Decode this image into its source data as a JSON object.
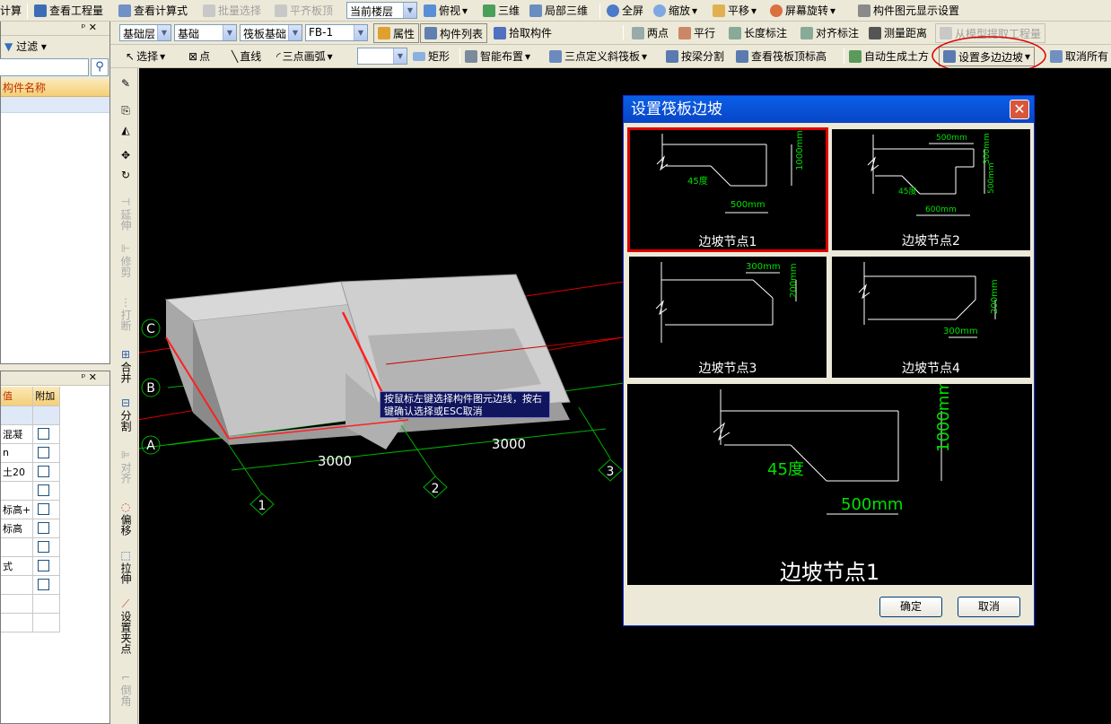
{
  "toolbar1": {
    "calc": "计算",
    "view_qty": "查看工程量",
    "view_formula": "查看计算式",
    "batch_select": "批量选择",
    "flush_top": "平齐板顶",
    "floor_select": "当前楼层",
    "top_view": "俯视",
    "three_d": "三维",
    "partial_3d": "局部三维",
    "fullscreen": "全屏",
    "zoom": "缩放",
    "pan": "平移",
    "rotate": "屏幕旋转",
    "display_settings": "构件图元显示设置"
  },
  "toolbar2": {
    "layer": "基础层",
    "category": "基础",
    "type": "筏板基础",
    "element": "FB-1",
    "properties": "属性",
    "element_list": "构件列表",
    "pick_element": "拾取构件",
    "two_points": "两点",
    "parallel": "平行",
    "length_dim": "长度标注",
    "align_dim": "对齐标注",
    "measure": "测量距离",
    "extract_model": "从模型提取工程量"
  },
  "toolbar3": {
    "select": "选择",
    "point": "点",
    "line": "直线",
    "arc3": "三点画弧",
    "rect": "矩形",
    "smart_layout": "智能布置",
    "define_slope": "三点定义斜筏板",
    "split_beam": "按梁分割",
    "view_top_elev": "查看筏板顶标高",
    "auto_earthwork": "自动生成土方",
    "set_multi_slope": "设置多边边坡",
    "cancel_all": "取消所有"
  },
  "left_panel": {
    "filter": "过滤",
    "col_name": "构件名称",
    "props_col_value": "值",
    "props_col_extra": "附加",
    "props_values": [
      "",
      "混凝",
      "n",
      "土20",
      "",
      "标高+",
      "标高",
      "",
      "式",
      "",
      "",
      ""
    ]
  },
  "side_tools": [
    "延伸",
    "修剪",
    "打断",
    "合并",
    "分割",
    "对齐",
    "偏移",
    "拉伸",
    "设置夹点",
    "倒角"
  ],
  "canvas": {
    "axes_letters": [
      "C",
      "B",
      "A"
    ],
    "axes_numbers": [
      "1",
      "2",
      "3"
    ],
    "dim_left": "3000",
    "dim_right": "3000",
    "hint": "按鼠标左键选择构件图元边线，按右键确认选择或ESC取消"
  },
  "dialog": {
    "title": "设置筏板边坡",
    "close": "✕",
    "ok": "确定",
    "cancel": "取消",
    "nodes": [
      {
        "caption": "边坡节点1",
        "dims": [
          "1000mm",
          "45度",
          "500mm"
        ]
      },
      {
        "caption": "边坡节点2",
        "dims": [
          "500mm",
          "300mm",
          "500mm",
          "45度",
          "600mm"
        ]
      },
      {
        "caption": "边坡节点3",
        "dims": [
          "300mm",
          "200mm"
        ]
      },
      {
        "caption": "边坡节点4",
        "dims": [
          "200mm",
          "300mm"
        ]
      }
    ],
    "preview": {
      "caption": "边坡节点1",
      "dim_h": "1000mm",
      "angle": "45度",
      "dim_w": "500mm"
    }
  },
  "colors": {
    "accent_red": "#d00",
    "dim_green": "#00e000",
    "canvas_bg": "#000000"
  }
}
